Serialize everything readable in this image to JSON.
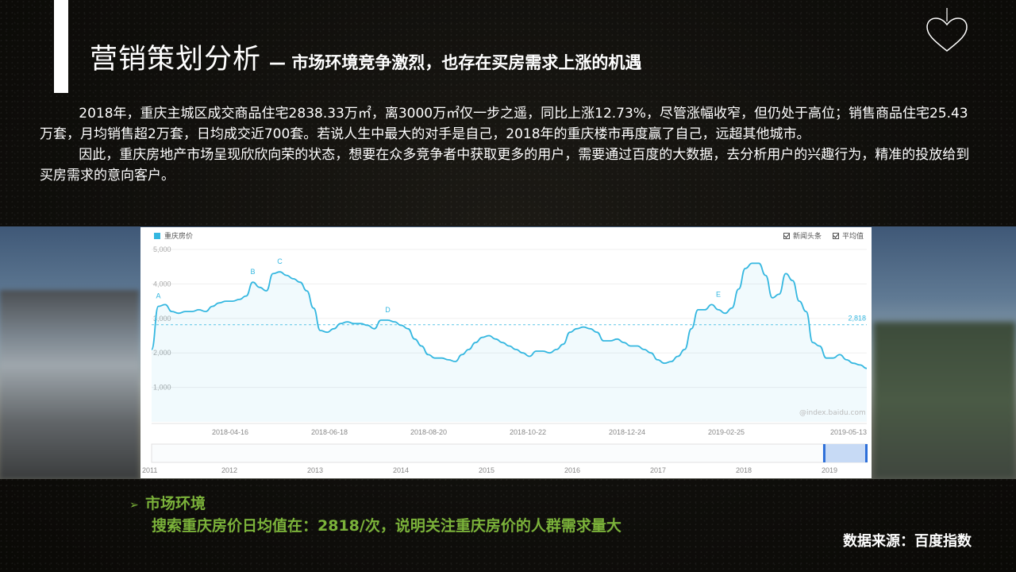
{
  "slide": {
    "title": "营销策划分析",
    "subtitle": "— 市场环境竞争激烈，也存在买房需求上涨的机遇",
    "paragraphs": [
      "2018年，重庆主城区成交商品住宅2838.33万㎡，离3000万㎡仅一步之遥，同比上涨12.73%，尽管涨幅收窄，但仍处于高位；销售商品住宅25.43万套，月均销售超2万套，日均成交近700套。若说人生中最大的对手是自己，2018年的重庆楼市再度赢了自己，远超其他城市。",
      "因此，重庆房地产市场呈现欣欣向荣的状态，想要在众多竞争者中获取更多的用户，需要通过百度的大数据，去分析用户的兴趣行为，精准的投放给到买房需求的意向客户。"
    ],
    "market": {
      "title": "市场环境",
      "detail": "搜索重庆房价日均值在：2818/次，说明关注重庆房价的人群需求量大"
    },
    "source": "数据来源：百度指数"
  },
  "chart_panel": {
    "legend": "重庆房价",
    "options": [
      "新闻头条",
      "平均值"
    ],
    "watermark": "@index.baidu.com",
    "overview_years": [
      "2011",
      "2012",
      "2013",
      "2014",
      "2015",
      "2016",
      "2017",
      "2018",
      "2019"
    ],
    "selection": [
      0.94,
      1.0
    ]
  },
  "colors": {
    "line": "#34b7e0",
    "average": "#34b7e0",
    "green_text": "#7bb23a"
  },
  "chart_data": {
    "type": "line",
    "series": [
      {
        "name": "重庆房价",
        "x": [
          "2018-03-15",
          "2018-03-19",
          "2018-03-23",
          "2018-03-27",
          "2018-03-31",
          "2018-04-04",
          "2018-04-08",
          "2018-04-12",
          "2018-04-16",
          "2018-04-20",
          "2018-04-24",
          "2018-04-28",
          "2018-05-02",
          "2018-05-06",
          "2018-05-10",
          "2018-05-14",
          "2018-05-18",
          "2018-05-22",
          "2018-05-26",
          "2018-05-30",
          "2018-06-03",
          "2018-06-07",
          "2018-06-11",
          "2018-06-15",
          "2018-06-19",
          "2018-06-23",
          "2018-06-27",
          "2018-07-01",
          "2018-07-05",
          "2018-07-09",
          "2018-07-13",
          "2018-07-17",
          "2018-07-21",
          "2018-07-25",
          "2018-07-29",
          "2018-08-02",
          "2018-08-06",
          "2018-08-10",
          "2018-08-14",
          "2018-08-18",
          "2018-08-22",
          "2018-08-26",
          "2018-08-30",
          "2018-09-03",
          "2018-09-07",
          "2018-09-11",
          "2018-09-15",
          "2018-09-19",
          "2018-09-23",
          "2018-09-27",
          "2018-10-01",
          "2018-10-05",
          "2018-10-09",
          "2018-10-13",
          "2018-10-17",
          "2018-10-21",
          "2018-10-25",
          "2018-10-29",
          "2018-11-02",
          "2018-11-06",
          "2018-11-10",
          "2018-11-14",
          "2018-11-18",
          "2018-11-22",
          "2018-11-26",
          "2018-11-30",
          "2018-12-04",
          "2018-12-08",
          "2018-12-12",
          "2018-12-16",
          "2018-12-20",
          "2018-12-24",
          "2018-12-28",
          "2019-01-01",
          "2019-01-05",
          "2019-01-09",
          "2019-01-13",
          "2019-01-17",
          "2019-01-21",
          "2019-01-25",
          "2019-01-29",
          "2019-02-02",
          "2019-02-06",
          "2019-02-10",
          "2019-02-14",
          "2019-02-18",
          "2019-02-22",
          "2019-02-26",
          "2019-03-02",
          "2019-03-06",
          "2019-03-10",
          "2019-03-14",
          "2019-03-18",
          "2019-03-22",
          "2019-03-26",
          "2019-03-30",
          "2019-04-03",
          "2019-04-07",
          "2019-04-11",
          "2019-04-15",
          "2019-04-19",
          "2019-04-23",
          "2019-04-27",
          "2019-05-01",
          "2019-05-05",
          "2019-05-09",
          "2019-05-13"
        ],
        "values": [
          2100,
          3350,
          3400,
          3200,
          3150,
          3200,
          3200,
          3250,
          3200,
          3350,
          3450,
          3500,
          3500,
          3550,
          3650,
          4050,
          3900,
          3800,
          4300,
          4350,
          4250,
          4150,
          4050,
          3800,
          3300,
          2650,
          2600,
          2700,
          2850,
          2900,
          2850,
          2850,
          2800,
          2700,
          2950,
          2950,
          2900,
          2800,
          2700,
          2400,
          2200,
          1950,
          1850,
          1850,
          1800,
          1750,
          1950,
          2100,
          2300,
          2450,
          2500,
          2400,
          2300,
          2200,
          2100,
          2000,
          1900,
          2050,
          2050,
          2000,
          2100,
          2250,
          2600,
          2700,
          2750,
          2700,
          2600,
          2350,
          2350,
          2400,
          2300,
          2200,
          2200,
          2100,
          2000,
          1800,
          1700,
          1750,
          1900,
          2100,
          2700,
          3250,
          3250,
          3400,
          3250,
          3150,
          3300,
          3850,
          4450,
          4600,
          4600,
          4250,
          3600,
          3700,
          4300,
          4100,
          3500,
          3200,
          2300,
          2200,
          1850,
          1850,
          1950,
          1800,
          1700,
          1650,
          1550
        ]
      }
    ],
    "xticks": [
      "2018-04-16",
      "2018-06-18",
      "2018-08-20",
      "2018-10-22",
      "2018-12-24",
      "2019-02-25",
      "2019-05-13"
    ],
    "yticks": [
      "1,000",
      "2,000",
      "3,000",
      "4,000",
      "5,000"
    ],
    "ylim": [
      0,
      5000
    ],
    "average": 2818,
    "average_label": "2,818",
    "annotations": [
      {
        "label": "A",
        "x": "2018-03-19",
        "y": 3350
      },
      {
        "label": "B",
        "x": "2018-05-14",
        "y": 4050
      },
      {
        "label": "C",
        "x": "2018-05-30",
        "y": 4350
      },
      {
        "label": "D",
        "x": "2018-08-02",
        "y": 2950
      },
      {
        "label": "E",
        "x": "2019-02-14",
        "y": 3400
      }
    ],
    "grid": true
  }
}
